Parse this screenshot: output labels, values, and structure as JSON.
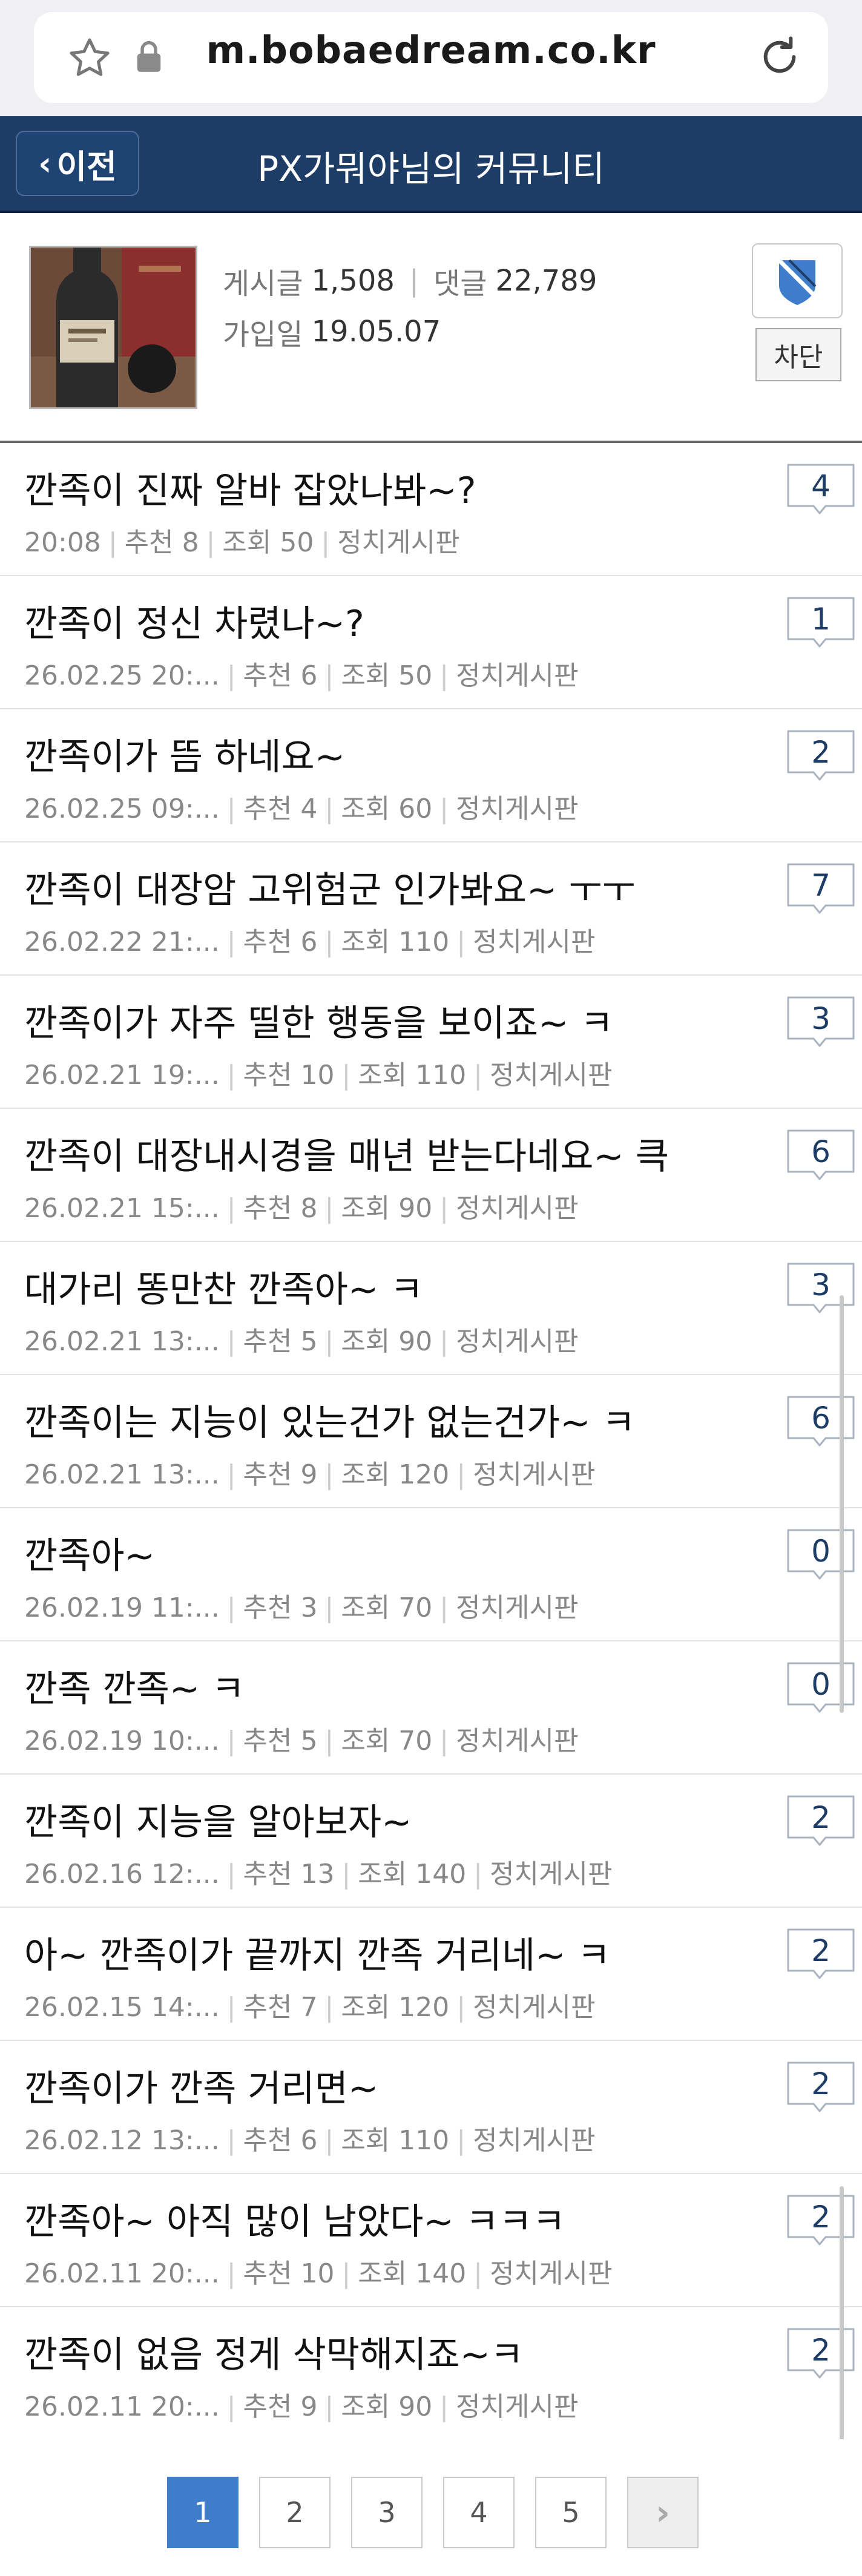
{
  "browser": {
    "url": "m.bobaedream.co.kr"
  },
  "header": {
    "back_label": "이전",
    "title": "PX가뭐야님의 커뮤니티"
  },
  "profile": {
    "posts_label": "게시글",
    "posts_count": "1,508",
    "comments_label": "댓글",
    "comments_count": "22,789",
    "joined_label": "가입일",
    "joined_date": "19.05.07",
    "block_label": "차단"
  },
  "posts": [
    {
      "title": "깐족이 진짜 알바 잡았나봐~?",
      "date": "20:08",
      "rec": "추천 8",
      "views": "조회 50",
      "board": "정치게시판",
      "comments": "4"
    },
    {
      "title": "깐족이 정신 차렸나~?",
      "date": "26.02.25  20:...",
      "rec": "추천 6",
      "views": "조회 50",
      "board": "정치게시판",
      "comments": "1"
    },
    {
      "title": "깐족이가 뜸 하네요~",
      "date": "26.02.25  09:...",
      "rec": "추천 4",
      "views": "조회 60",
      "board": "정치게시판",
      "comments": "2"
    },
    {
      "title": "깐족이 대장암 고위험군 인가봐요~ ㅜㅜ",
      "date": "26.02.22  21:...",
      "rec": "추천 6",
      "views": "조회 110",
      "board": "정치게시판",
      "comments": "7"
    },
    {
      "title": "깐족이가 자주 띨한 행동을 보이죠~ ㅋ",
      "date": "26.02.21  19:...",
      "rec": "추천 10",
      "views": "조회 110",
      "board": "정치게시판",
      "comments": "3"
    },
    {
      "title": "깐족이 대장내시경을 매년 받는다네요~ 큭",
      "date": "26.02.21  15:...",
      "rec": "추천 8",
      "views": "조회 90",
      "board": "정치게시판",
      "comments": "6"
    },
    {
      "title": "대가리 똥만찬 깐족아~ ㅋ",
      "date": "26.02.21  13:...",
      "rec": "추천 5",
      "views": "조회 90",
      "board": "정치게시판",
      "comments": "3"
    },
    {
      "title": "깐족이는 지능이 있는건가 없는건가~ ㅋ",
      "date": "26.02.21  13:...",
      "rec": "추천 9",
      "views": "조회 120",
      "board": "정치게시판",
      "comments": "6"
    },
    {
      "title": "깐족아~",
      "date": "26.02.19  11:...",
      "rec": "추천 3",
      "views": "조회 70",
      "board": "정치게시판",
      "comments": "0"
    },
    {
      "title": "깐족 깐족~ ㅋ",
      "date": "26.02.19  10:...",
      "rec": "추천 5",
      "views": "조회 70",
      "board": "정치게시판",
      "comments": "0"
    },
    {
      "title": "깐족이 지능을 알아보자~",
      "date": "26.02.16  12:...",
      "rec": "추천 13",
      "views": "조회 140",
      "board": "정치게시판",
      "comments": "2"
    },
    {
      "title": "아~ 깐족이가 끝까지 깐족 거리네~ ㅋ",
      "date": "26.02.15  14:...",
      "rec": "추천 7",
      "views": "조회 120",
      "board": "정치게시판",
      "comments": "2"
    },
    {
      "title": "깐족이가 깐족 거리면~",
      "date": "26.02.12  13:...",
      "rec": "추천 6",
      "views": "조회 110",
      "board": "정치게시판",
      "comments": "2"
    },
    {
      "title": "깐족아~ 아직 많이 남았다~ ㅋㅋㅋ",
      "date": "26.02.11  20:...",
      "rec": "추천 10",
      "views": "조회 140",
      "board": "정치게시판",
      "comments": "2"
    },
    {
      "title": "깐족이 없음 정게 삭막해지죠~ㅋ",
      "date": "26.02.11  20:...",
      "rec": "추천 9",
      "views": "조회 90",
      "board": "정치게시판",
      "comments": "2"
    }
  ],
  "pagination": {
    "pages": [
      "1",
      "2",
      "3",
      "4",
      "5"
    ],
    "current": "1",
    "next_label": "›"
  },
  "colors": {
    "header_bg": "#1d3d66",
    "accent": "#3f7ccc"
  }
}
